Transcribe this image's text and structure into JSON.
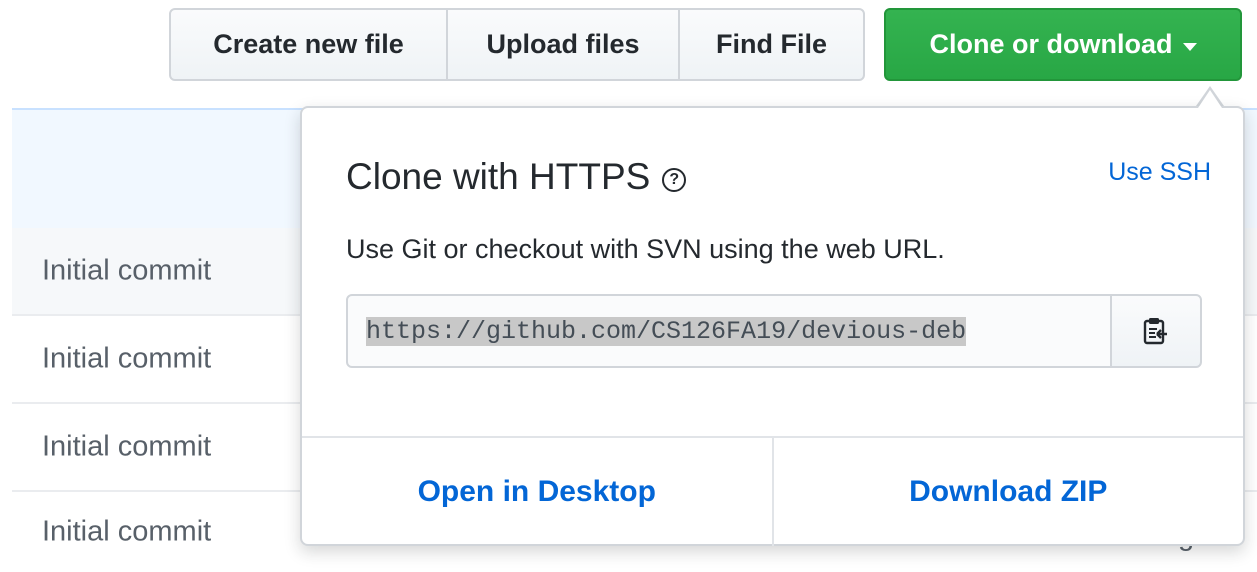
{
  "toolbar": {
    "create_new_file": "Create new file",
    "upload_files": "Upload files",
    "find_file": "Find File",
    "clone_or_download": "Clone or download"
  },
  "file_list": {
    "rows": [
      {
        "commit_message": "Initial commit"
      },
      {
        "commit_message": "Initial commit"
      },
      {
        "commit_message": "Initial commit"
      },
      {
        "commit_message": "Initial commit"
      }
    ],
    "peek_text": "g"
  },
  "clone_popover": {
    "title": "Clone with HTTPS",
    "help_icon": "question-circle-icon",
    "use_ssh": "Use SSH",
    "description": "Use Git or checkout with SVN using the web URL.",
    "url": "https://github.com/CS126FA19/devious-deb",
    "copy_icon": "clipboard-icon",
    "open_in_desktop": "Open in Desktop",
    "download_zip": "Download ZIP"
  },
  "colors": {
    "clone_button": "#28a745",
    "link": "#0366d6",
    "header_bg": "#f1f8ff"
  }
}
